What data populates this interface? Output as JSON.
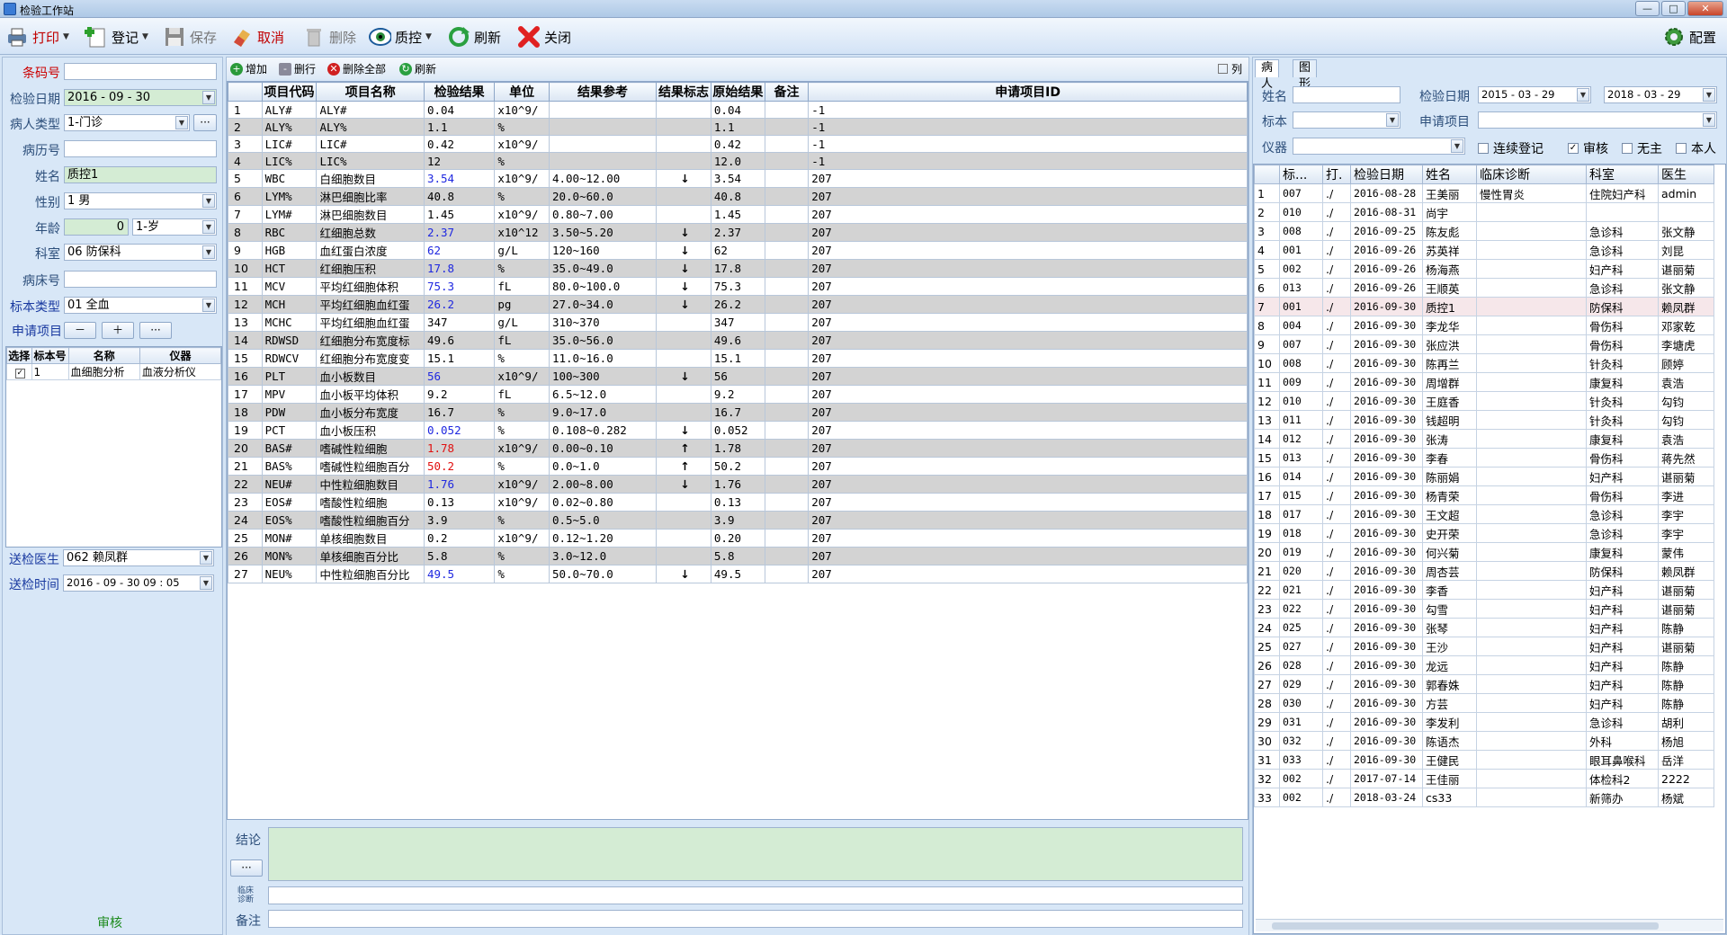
{
  "window": {
    "title": "检验工作站",
    "min": "—",
    "max": "□",
    "close": "✕"
  },
  "toolbar": {
    "print": "打印",
    "register": "登记",
    "save": "保存",
    "cancel": "取消",
    "delete": "删除",
    "qc": "质控",
    "refresh": "刷新",
    "close": "关闭",
    "config": "配置"
  },
  "left": {
    "barcode_label": "条码号",
    "barcode": "",
    "date_label": "检验日期",
    "date": "2016 - 09 - 30",
    "ptype_label": "病人类型",
    "ptype": "1-门诊",
    "record_label": "病历号",
    "record": "",
    "name_label": "姓名",
    "name": "质控1",
    "sex_label": "性别",
    "sex": "1 男",
    "age_label": "年龄",
    "age": "0",
    "age_unit": "1-岁",
    "dept_label": "科室",
    "dept": "06 防保科",
    "bed_label": "病床号",
    "bed": "",
    "sample_label": "标本类型",
    "sample": "01 全血",
    "apply_label": "申请项目",
    "minus": "－",
    "plus": "＋",
    "more": "···",
    "mini_headers": [
      "选择",
      "标本号",
      "名称",
      "仪器"
    ],
    "mini_rows": [
      {
        "no": "1",
        "name": "血细胞分析",
        "inst": "血液分析仪"
      }
    ],
    "doctor_label": "送检医生",
    "doctor": "062 赖凤群",
    "time_label": "送检时间",
    "time": "2016 - 09 - 30   09 : 05",
    "status": "审核"
  },
  "mid": {
    "add": "增加",
    "delrow": "删行",
    "delall": "删除全部",
    "refresh": "刷新",
    "col": "列",
    "headers": [
      "项目代码",
      "项目名称",
      "检验结果",
      "单位",
      "结果参考",
      "结果标志",
      "原始结果",
      "备注",
      "申请项目ID"
    ],
    "rows": [
      {
        "n": "1",
        "code": "ALY#",
        "name": "ALY#",
        "res": "0.04",
        "unit": "x10^9/",
        "ref": "",
        "flag": "",
        "raw": "0.04",
        "note": "",
        "id": "-1",
        "c": ""
      },
      {
        "n": "2",
        "code": "ALY%",
        "name": "ALY%",
        "res": "1.1",
        "unit": "%",
        "ref": "",
        "flag": "",
        "raw": "1.1",
        "note": "",
        "id": "-1",
        "c": ""
      },
      {
        "n": "3",
        "code": "LIC#",
        "name": "LIC#",
        "res": "0.42",
        "unit": "x10^9/",
        "ref": "",
        "flag": "",
        "raw": "0.42",
        "note": "",
        "id": "-1",
        "c": ""
      },
      {
        "n": "4",
        "code": "LIC%",
        "name": "LIC%",
        "res": "12",
        "unit": "%",
        "ref": "",
        "flag": "",
        "raw": "12.0",
        "note": "",
        "id": "-1",
        "c": ""
      },
      {
        "n": "5",
        "code": "WBC",
        "name": "白细胞数目",
        "res": "3.54",
        "unit": "x10^9/",
        "ref": "4.00~12.00",
        "flag": "↓",
        "raw": "3.54",
        "note": "",
        "id": "207",
        "c": "blue"
      },
      {
        "n": "6",
        "code": "LYM%",
        "name": "淋巴细胞比率",
        "res": "40.8",
        "unit": "%",
        "ref": "20.0~60.0",
        "flag": "",
        "raw": "40.8",
        "note": "",
        "id": "207",
        "c": ""
      },
      {
        "n": "7",
        "code": "LYM#",
        "name": "淋巴细胞数目",
        "res": "1.45",
        "unit": "x10^9/",
        "ref": "0.80~7.00",
        "flag": "",
        "raw": "1.45",
        "note": "",
        "id": "207",
        "c": ""
      },
      {
        "n": "8",
        "code": "RBC",
        "name": "红细胞总数",
        "res": "2.37",
        "unit": "x10^12",
        "ref": "3.50~5.20",
        "flag": "↓",
        "raw": "2.37",
        "note": "",
        "id": "207",
        "c": "blue"
      },
      {
        "n": "9",
        "code": "HGB",
        "name": "血红蛋白浓度",
        "res": "62",
        "unit": "g/L",
        "ref": "120~160",
        "flag": "↓",
        "raw": "62",
        "note": "",
        "id": "207",
        "c": "blue"
      },
      {
        "n": "10",
        "code": "HCT",
        "name": "红细胞压积",
        "res": "17.8",
        "unit": "%",
        "ref": "35.0~49.0",
        "flag": "↓",
        "raw": "17.8",
        "note": "",
        "id": "207",
        "c": "blue"
      },
      {
        "n": "11",
        "code": "MCV",
        "name": "平均红细胞体积",
        "res": "75.3",
        "unit": "fL",
        "ref": "80.0~100.0",
        "flag": "↓",
        "raw": "75.3",
        "note": "",
        "id": "207",
        "c": "blue"
      },
      {
        "n": "12",
        "code": "MCH",
        "name": "平均红细胞血红蛋",
        "res": "26.2",
        "unit": "pg",
        "ref": "27.0~34.0",
        "flag": "↓",
        "raw": "26.2",
        "note": "",
        "id": "207",
        "c": "blue"
      },
      {
        "n": "13",
        "code": "MCHC",
        "name": "平均红细胞血红蛋",
        "res": "347",
        "unit": "g/L",
        "ref": "310~370",
        "flag": "",
        "raw": "347",
        "note": "",
        "id": "207",
        "c": ""
      },
      {
        "n": "14",
        "code": "RDWSD",
        "name": "红细胞分布宽度标",
        "res": "49.6",
        "unit": "fL",
        "ref": "35.0~56.0",
        "flag": "",
        "raw": "49.6",
        "note": "",
        "id": "207",
        "c": ""
      },
      {
        "n": "15",
        "code": "RDWCV",
        "name": "红细胞分布宽度变",
        "res": "15.1",
        "unit": "%",
        "ref": "11.0~16.0",
        "flag": "",
        "raw": "15.1",
        "note": "",
        "id": "207",
        "c": ""
      },
      {
        "n": "16",
        "code": "PLT",
        "name": "血小板数目",
        "res": "56",
        "unit": "x10^9/",
        "ref": "100~300",
        "flag": "↓",
        "raw": "56",
        "note": "",
        "id": "207",
        "c": "blue"
      },
      {
        "n": "17",
        "code": "MPV",
        "name": "血小板平均体积",
        "res": "9.2",
        "unit": "fL",
        "ref": "6.5~12.0",
        "flag": "",
        "raw": "9.2",
        "note": "",
        "id": "207",
        "c": ""
      },
      {
        "n": "18",
        "code": "PDW",
        "name": "血小板分布宽度",
        "res": "16.7",
        "unit": "%",
        "ref": "9.0~17.0",
        "flag": "",
        "raw": "16.7",
        "note": "",
        "id": "207",
        "c": ""
      },
      {
        "n": "19",
        "code": "PCT",
        "name": "血小板压积",
        "res": "0.052",
        "unit": "%",
        "ref": "0.108~0.282",
        "flag": "↓",
        "raw": "0.052",
        "note": "",
        "id": "207",
        "c": "blue"
      },
      {
        "n": "20",
        "code": "BAS#",
        "name": "嗜碱性粒细胞",
        "res": "1.78",
        "unit": "x10^9/",
        "ref": "0.00~0.10",
        "flag": "↑",
        "raw": "1.78",
        "note": "",
        "id": "207",
        "c": "rd"
      },
      {
        "n": "21",
        "code": "BAS%",
        "name": "嗜碱性粒细胞百分",
        "res": "50.2",
        "unit": "%",
        "ref": "0.0~1.0",
        "flag": "↑",
        "raw": "50.2",
        "note": "",
        "id": "207",
        "c": "rd"
      },
      {
        "n": "22",
        "code": "NEU#",
        "name": "中性粒细胞数目",
        "res": "1.76",
        "unit": "x10^9/",
        "ref": "2.00~8.00",
        "flag": "↓",
        "raw": "1.76",
        "note": "",
        "id": "207",
        "c": "blue"
      },
      {
        "n": "23",
        "code": "EOS#",
        "name": "嗜酸性粒细胞",
        "res": "0.13",
        "unit": "x10^9/",
        "ref": "0.02~0.80",
        "flag": "",
        "raw": "0.13",
        "note": "",
        "id": "207",
        "c": ""
      },
      {
        "n": "24",
        "code": "EOS%",
        "name": "嗜酸性粒细胞百分",
        "res": "3.9",
        "unit": "%",
        "ref": "0.5~5.0",
        "flag": "",
        "raw": "3.9",
        "note": "",
        "id": "207",
        "c": ""
      },
      {
        "n": "25",
        "code": "MON#",
        "name": "单核细胞数目",
        "res": "0.2",
        "unit": "x10^9/",
        "ref": "0.12~1.20",
        "flag": "",
        "raw": "0.20",
        "note": "",
        "id": "207",
        "c": ""
      },
      {
        "n": "26",
        "code": "MON%",
        "name": "单核细胞百分比",
        "res": "5.8",
        "unit": "%",
        "ref": "3.0~12.0",
        "flag": "",
        "raw": "5.8",
        "note": "",
        "id": "207",
        "c": ""
      },
      {
        "n": "27",
        "code": "NEU%",
        "name": "中性粒细胞百分比",
        "res": "49.5",
        "unit": "%",
        "ref": "50.0~70.0",
        "flag": "↓",
        "raw": "49.5",
        "note": "",
        "id": "207",
        "c": "blue"
      }
    ],
    "concl_label": "结论",
    "concl_more": "···",
    "diag_label": "临床\n诊断",
    "note_label": "备注"
  },
  "right": {
    "tab_patient": "病人",
    "tab_graph": "图形",
    "name_label": "姓名",
    "date_label": "检验日期",
    "date_from": "2015 - 03 - 29",
    "date_to": "2018 - 03 - 29",
    "sample_label": "标本",
    "apply_label": "申请项目",
    "inst_label": "仪器",
    "cont_reg": "连续登记",
    "review": "审核",
    "no_match": "无主",
    "self": "本人",
    "headers": [
      "",
      "标...",
      "打.",
      "检验日期",
      "姓名",
      "临床诊断",
      "科室",
      "医生"
    ],
    "rows": [
      {
        "n": "1",
        "no": "007",
        "p": "./",
        "d": "2016-08-28",
        "name": "王美丽",
        "diag": "慢性胃炎",
        "dept": "住院妇产科",
        "doc": "admin"
      },
      {
        "n": "2",
        "no": "010",
        "p": "./",
        "d": "2016-08-31",
        "name": "尚宇",
        "diag": "",
        "dept": "",
        "doc": ""
      },
      {
        "n": "3",
        "no": "008",
        "p": "./",
        "d": "2016-09-25",
        "name": "陈友彪",
        "diag": "",
        "dept": "急诊科",
        "doc": "张文静"
      },
      {
        "n": "4",
        "no": "001",
        "p": "./",
        "d": "2016-09-26",
        "name": "苏英祥",
        "diag": "",
        "dept": "急诊科",
        "doc": "刘昆"
      },
      {
        "n": "5",
        "no": "002",
        "p": "./",
        "d": "2016-09-26",
        "name": "杨海燕",
        "diag": "",
        "dept": "妇产科",
        "doc": "谌丽菊"
      },
      {
        "n": "6",
        "no": "013",
        "p": "./",
        "d": "2016-09-26",
        "name": "王顺英",
        "diag": "",
        "dept": "急诊科",
        "doc": "张文静"
      },
      {
        "n": "7",
        "no": "001",
        "p": "./",
        "d": "2016-09-30",
        "name": "质控1",
        "diag": "",
        "dept": "防保科",
        "doc": "赖凤群",
        "sel": true
      },
      {
        "n": "8",
        "no": "004",
        "p": "./",
        "d": "2016-09-30",
        "name": "李龙华",
        "diag": "",
        "dept": "骨伤科",
        "doc": "邓家乾"
      },
      {
        "n": "9",
        "no": "007",
        "p": "./",
        "d": "2016-09-30",
        "name": "张应洪",
        "diag": "",
        "dept": "骨伤科",
        "doc": "李塘虎"
      },
      {
        "n": "10",
        "no": "008",
        "p": "./",
        "d": "2016-09-30",
        "name": "陈再兰",
        "diag": "",
        "dept": "针灸科",
        "doc": "顾婷"
      },
      {
        "n": "11",
        "no": "009",
        "p": "./",
        "d": "2016-09-30",
        "name": "周增群",
        "diag": "",
        "dept": "康复科",
        "doc": "袁浩"
      },
      {
        "n": "12",
        "no": "010",
        "p": "./",
        "d": "2016-09-30",
        "name": "王庭香",
        "diag": "",
        "dept": "针灸科",
        "doc": "勾钧"
      },
      {
        "n": "13",
        "no": "011",
        "p": "./",
        "d": "2016-09-30",
        "name": "钱超明",
        "diag": "",
        "dept": "针灸科",
        "doc": "勾钧"
      },
      {
        "n": "14",
        "no": "012",
        "p": "./",
        "d": "2016-09-30",
        "name": "张涛",
        "diag": "",
        "dept": "康复科",
        "doc": "袁浩"
      },
      {
        "n": "15",
        "no": "013",
        "p": "./",
        "d": "2016-09-30",
        "name": "李春",
        "diag": "",
        "dept": "骨伤科",
        "doc": "蒋先然"
      },
      {
        "n": "16",
        "no": "014",
        "p": "./",
        "d": "2016-09-30",
        "name": "陈丽娟",
        "diag": "",
        "dept": "妇产科",
        "doc": "谌丽菊"
      },
      {
        "n": "17",
        "no": "015",
        "p": "./",
        "d": "2016-09-30",
        "name": "杨青荣",
        "diag": "",
        "dept": "骨伤科",
        "doc": "李进"
      },
      {
        "n": "18",
        "no": "017",
        "p": "./",
        "d": "2016-09-30",
        "name": "王文超",
        "diag": "",
        "dept": "急诊科",
        "doc": "李宇"
      },
      {
        "n": "19",
        "no": "018",
        "p": "./",
        "d": "2016-09-30",
        "name": "史开荣",
        "diag": "",
        "dept": "急诊科",
        "doc": "李宇"
      },
      {
        "n": "20",
        "no": "019",
        "p": "./",
        "d": "2016-09-30",
        "name": "何兴菊",
        "diag": "",
        "dept": "康复科",
        "doc": "蒙伟"
      },
      {
        "n": "21",
        "no": "020",
        "p": "./",
        "d": "2016-09-30",
        "name": "周杏芸",
        "diag": "",
        "dept": "防保科",
        "doc": "赖凤群"
      },
      {
        "n": "22",
        "no": "021",
        "p": "./",
        "d": "2016-09-30",
        "name": "李香",
        "diag": "",
        "dept": "妇产科",
        "doc": "谌丽菊"
      },
      {
        "n": "23",
        "no": "022",
        "p": "./",
        "d": "2016-09-30",
        "name": "勾雪",
        "diag": "",
        "dept": "妇产科",
        "doc": "谌丽菊"
      },
      {
        "n": "24",
        "no": "025",
        "p": "./",
        "d": "2016-09-30",
        "name": "张琴",
        "diag": "",
        "dept": "妇产科",
        "doc": "陈静"
      },
      {
        "n": "25",
        "no": "027",
        "p": "./",
        "d": "2016-09-30",
        "name": "王沙",
        "diag": "",
        "dept": "妇产科",
        "doc": "谌丽菊"
      },
      {
        "n": "26",
        "no": "028",
        "p": "./",
        "d": "2016-09-30",
        "name": "龙远",
        "diag": "",
        "dept": "妇产科",
        "doc": "陈静"
      },
      {
        "n": "27",
        "no": "029",
        "p": "./",
        "d": "2016-09-30",
        "name": "郭春姝",
        "diag": "",
        "dept": "妇产科",
        "doc": "陈静"
      },
      {
        "n": "28",
        "no": "030",
        "p": "./",
        "d": "2016-09-30",
        "name": "方芸",
        "diag": "",
        "dept": "妇产科",
        "doc": "陈静"
      },
      {
        "n": "29",
        "no": "031",
        "p": "./",
        "d": "2016-09-30",
        "name": "李发利",
        "diag": "",
        "dept": "急诊科",
        "doc": "胡利"
      },
      {
        "n": "30",
        "no": "032",
        "p": "./",
        "d": "2016-09-30",
        "name": "陈语杰",
        "diag": "",
        "dept": "外科",
        "doc": "杨旭"
      },
      {
        "n": "31",
        "no": "033",
        "p": "./",
        "d": "2016-09-30",
        "name": "王健民",
        "diag": "",
        "dept": "眼耳鼻喉科",
        "doc": "岳洋"
      },
      {
        "n": "32",
        "no": "002",
        "p": "./",
        "d": "2017-07-14",
        "name": "王佳丽",
        "diag": "",
        "dept": "体检科2",
        "doc": "2222"
      },
      {
        "n": "33",
        "no": "002",
        "p": "./",
        "d": "2018-03-24",
        "name": "cs33",
        "diag": "",
        "dept": "新筛办",
        "doc": "杨斌"
      }
    ]
  }
}
